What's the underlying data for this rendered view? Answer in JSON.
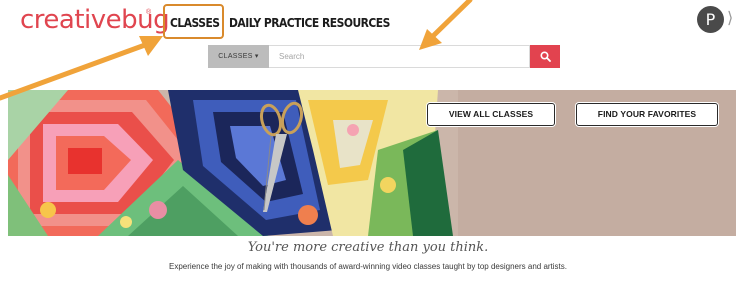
{
  "brand": {
    "logo_text": "creativebug",
    "logo_mark": "®"
  },
  "nav": {
    "classes": "CLASSES",
    "daily_practice": "DAILY PRACTICE",
    "resources": "RESOURCES"
  },
  "user": {
    "avatar_initial": "P",
    "menu_caret": "⟩"
  },
  "search": {
    "category_label": "CLASSES ▾",
    "placeholder": "Search",
    "value": ""
  },
  "hero": {
    "view_all_label": "VIEW ALL CLASSES",
    "favorites_label": "FIND YOUR FAVORITES"
  },
  "tagline": "You're more creative than you think.",
  "subtagline": "Experience the joy of making with thousands of award-winning video classes taught by top designers and artists.",
  "colors": {
    "brand": "#e0454f",
    "search_button": "#e2434f",
    "annotation_arrow": "#f0a33a"
  },
  "icons": {
    "search_button": "search-icon",
    "annotation": "arrow-pointer-icon"
  }
}
